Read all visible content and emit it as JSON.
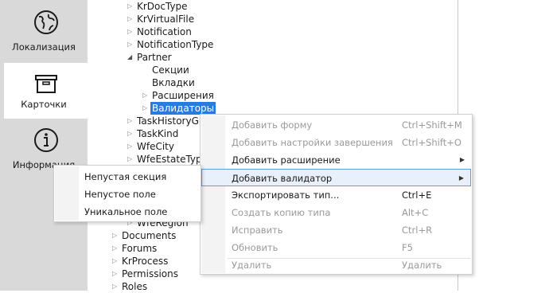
{
  "nav": {
    "items": [
      {
        "label": "Локализация",
        "icon": "globe-icon"
      },
      {
        "label": "Карточки",
        "icon": "box-icon"
      },
      {
        "label": "Информация",
        "icon": "info-icon"
      }
    ]
  },
  "tree": {
    "rows": [
      {
        "label": "KrDocType",
        "arrow": "▷"
      },
      {
        "label": "KrVirtualFile",
        "arrow": "▷"
      },
      {
        "label": "Notification",
        "arrow": "▷"
      },
      {
        "label": "NotificationType",
        "arrow": "▷"
      },
      {
        "label": "Partner",
        "arrow": "◢"
      },
      {
        "label": "Секции",
        "arrow": ""
      },
      {
        "label": "Вкладки",
        "arrow": ""
      },
      {
        "label": "Расширения",
        "arrow": "▷"
      },
      {
        "label": "Валидаторы",
        "arrow": "▷"
      },
      {
        "label": "TaskHistoryGro",
        "arrow": "▷"
      },
      {
        "label": "TaskKind",
        "arrow": "▷"
      },
      {
        "label": "WfeCity",
        "arrow": "▷"
      },
      {
        "label": "WfeEstateType",
        "arrow": "▷"
      },
      {
        "label": "WfeRegion",
        "arrow": "▷"
      },
      {
        "label": "Documents",
        "arrow": "▷"
      },
      {
        "label": "Forums",
        "arrow": "▷"
      },
      {
        "label": "KrProcess",
        "arrow": "▷"
      },
      {
        "label": "Permissions",
        "arrow": "▷"
      },
      {
        "label": "Roles",
        "arrow": "▷"
      }
    ]
  },
  "context_menu": {
    "items": [
      {
        "label": "Добавить форму",
        "shortcut": "Ctrl+Shift+M"
      },
      {
        "label": "Добавить настройки завершения",
        "shortcut": "Ctrl+Shift+O"
      },
      {
        "label": "Добавить расширение",
        "shortcut": ""
      },
      {
        "label": "Добавить валидатор",
        "shortcut": ""
      },
      {
        "label": "Экспортировать тип...",
        "shortcut": "Ctrl+E"
      },
      {
        "label": "Создать копию типа",
        "shortcut": "Alt+C"
      },
      {
        "label": "Исправить",
        "shortcut": "Ctrl+R"
      },
      {
        "label": "Обновить",
        "shortcut": "F5"
      },
      {
        "label": "Удалить",
        "shortcut": "Удалить"
      }
    ],
    "submenu_arrow": "▶"
  },
  "submenu": {
    "items": [
      {
        "label": "Непустая секция"
      },
      {
        "label": "Непустое поле"
      },
      {
        "label": "Уникальное поле"
      }
    ]
  },
  "colors": {
    "selection": "#2a7bde",
    "hover_border": "#5e9de6",
    "disabled_text": "#9a9a9a"
  }
}
